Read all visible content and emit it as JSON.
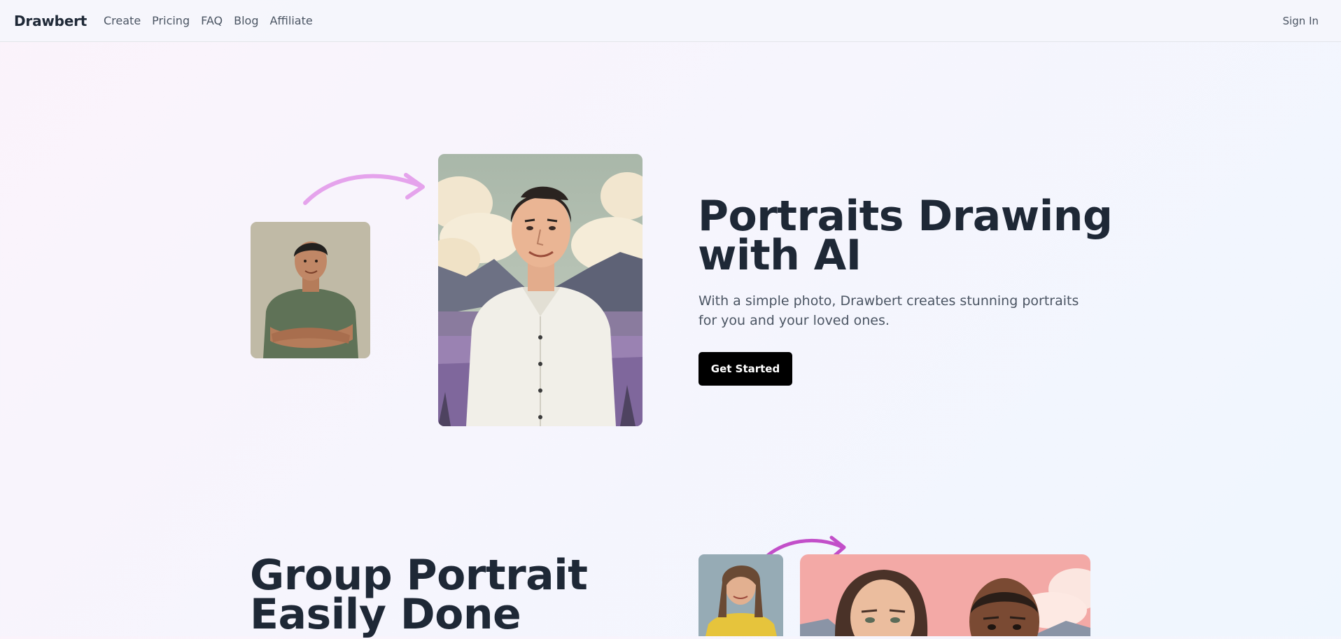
{
  "nav": {
    "brand": "Drawbert",
    "links": [
      {
        "label": "Create"
      },
      {
        "label": "Pricing"
      },
      {
        "label": "FAQ"
      },
      {
        "label": "Blog"
      },
      {
        "label": "Affiliate"
      }
    ],
    "signin": "Sign In"
  },
  "hero": {
    "title": "Portraits Drawing with AI",
    "subtitle": "With a simple photo, Drawbert creates stunning portraits for you and your loved ones.",
    "cta": "Get Started",
    "before_image": "man-photo",
    "after_image": "man-ai-portrait"
  },
  "section2": {
    "title": "Group Portrait Easily Done",
    "before_image": "woman-photo",
    "after_image": "couple-ai-portrait"
  },
  "colors": {
    "arrow_top": "#e5a3ec",
    "arrow_bottom": "#c24fc9",
    "cta_bg": "#000000",
    "heading": "#1e2836"
  }
}
